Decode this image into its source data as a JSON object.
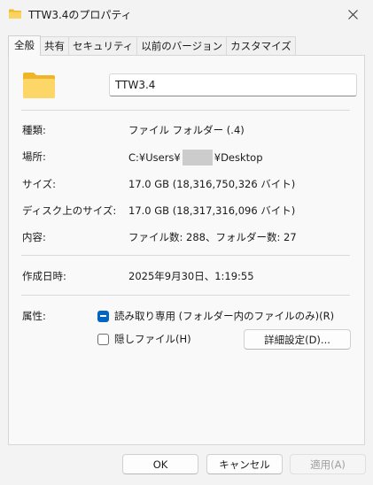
{
  "window": {
    "title": "TTW3.4のプロパティ",
    "close_icon": "close-icon",
    "folder_color": "#f7c948"
  },
  "tabs": [
    {
      "label": "全般",
      "active": true
    },
    {
      "label": "共有",
      "active": false
    },
    {
      "label": "セキュリティ",
      "active": false
    },
    {
      "label": "以前のバージョン",
      "active": false
    },
    {
      "label": "カスタマイズ",
      "active": false
    }
  ],
  "general": {
    "folder_name": "TTW3.4",
    "type_label": "種類:",
    "type_value": "ファイル フォルダー (.4)",
    "location_label": "場所:",
    "location_prefix": "C:¥Users¥",
    "location_suffix": "¥Desktop",
    "size_label": "サイズ:",
    "size_value": "17.0 GB (18,316,750,326 バイト)",
    "disk_size_label": "ディスク上のサイズ:",
    "disk_size_value": "17.0 GB (18,317,316,096 バイト)",
    "contents_label": "内容:",
    "contents_value": "ファイル数: 288、フォルダー数: 27",
    "created_label": "作成日時:",
    "created_value": "2025年9月30日、1:19:55",
    "attributes_label": "属性:",
    "readonly_label": "読み取り専用 (フォルダー内のファイルのみ)(R)",
    "readonly_state": "indeterminate",
    "hidden_label": "隠しファイル(H)",
    "hidden_state": "unchecked",
    "advanced_button": "詳細設定(D)..."
  },
  "footer": {
    "ok": "OK",
    "cancel": "キャンセル",
    "apply": "適用(A)"
  },
  "colors": {
    "accent": "#0067c0"
  }
}
